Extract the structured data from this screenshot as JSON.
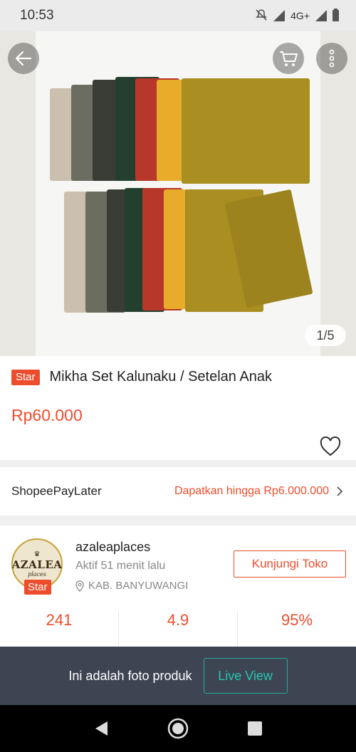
{
  "status_bar": {
    "time": "10:53",
    "network": "4G+"
  },
  "image": {
    "counter": "1/5"
  },
  "product": {
    "badge": "Star",
    "title": "Mikha Set Kalunaku / Setelan Anak",
    "price": "Rp60.000"
  },
  "paylater": {
    "label": "ShopeePayLater",
    "offer": "Dapatkan hingga Rp6.000.000"
  },
  "shop": {
    "logo_text": "AZALEA",
    "logo_sub": "places",
    "badge": "Star",
    "name": "azaleaplaces",
    "active": "Aktif 51 menit lalu",
    "location": "KAB. BANYUWANGI",
    "visit_label": "Kunjungi Toko",
    "stats": [
      {
        "value": "241"
      },
      {
        "value": "4.9"
      },
      {
        "value": "95%"
      }
    ]
  },
  "live_banner": {
    "text": "Ini adalah foto produk",
    "button": "Live View"
  },
  "colors": {
    "accent": "#ee4d2d",
    "teal": "#26aa99"
  }
}
